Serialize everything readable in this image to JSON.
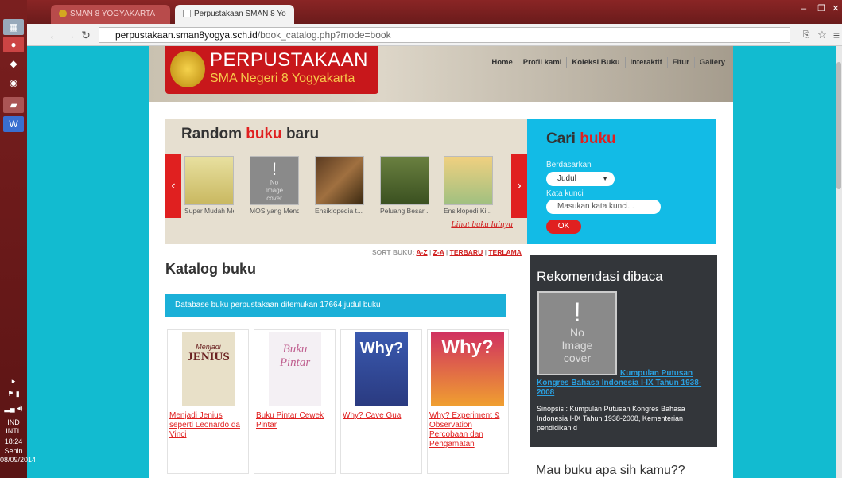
{
  "taskbar": {
    "tray": {
      "lang1": "IND",
      "lang2": "INTL",
      "time": "18:24",
      "day": "Senin",
      "date": "08/09/2014"
    }
  },
  "browser": {
    "tabs": [
      {
        "label": "SMAN 8 YOGYAKARTA",
        "active": false
      },
      {
        "label": "Perpustakaan SMAN 8 Yo",
        "active": true
      }
    ],
    "url_host": "perpustakaan.sman8yogya.sch.id",
    "url_path": "/book_catalog.php?mode=book"
  },
  "header": {
    "logo_title": "PERPUSTAKAAN",
    "logo_subtitle": "SMA Negeri 8 Yogyakarta",
    "menu": [
      "Home",
      "Profil kami",
      "Koleksi Buku",
      "Interaktif",
      "Fitur",
      "Gallery"
    ]
  },
  "random": {
    "title_a": "Random ",
    "title_b": "buku",
    "title_c": " baru",
    "books": [
      {
        "caption": "Super Mudah Me..."
      },
      {
        "caption": "MOS yang Mendi..."
      },
      {
        "caption": "Ensiklopedia t..."
      },
      {
        "caption": "Peluang Besar ..."
      },
      {
        "caption": "Ensiklopedi Ki..."
      }
    ],
    "no_image": {
      "line1": "No",
      "line2": "Image",
      "line3": "cover"
    },
    "more_link": "Lihat buku lainya"
  },
  "search": {
    "title_a": "Cari ",
    "title_b": "buku",
    "label_by": "Berdasarkan",
    "select_value": "Judul",
    "label_keyword": "Kata kunci",
    "keyword_placeholder": "Masukan kata kunci...",
    "ok_label": "OK"
  },
  "sort": {
    "prefix": "SORT BUKU: ",
    "options": [
      "A-Z",
      "Z-A",
      "TERBARU",
      "TERLAMA"
    ],
    "sep": " | "
  },
  "catalog": {
    "title": "Katalog buku",
    "db_text": "Database buku perpustakaan ditemukan 17664 judul buku",
    "books": [
      {
        "caption": "Menjadi Jenius seperti Leonardo da Vinci",
        "cover_top": "Menjadi",
        "cover_big": "JENIUS"
      },
      {
        "caption": "Buku Pintar Cewek Pintar",
        "cover_top": "Buku",
        "cover_big": "Pintar"
      },
      {
        "caption": "Why? Cave Gua",
        "cover_top": "",
        "cover_big": "Why?"
      },
      {
        "caption": "Why? Experiment & Observation Percobaan dan Pengamatan",
        "cover_top": "",
        "cover_big": "Why?"
      }
    ]
  },
  "recommend": {
    "heading": "Rekomendasi dibaca",
    "no_image": {
      "line1": "No",
      "line2": "Image",
      "line3": "cover"
    },
    "title_link": "Kumpulan Putusan Kongres Bahasa Indonesia I-IX Tahun 1938-2008",
    "synopsis": "Sinopsis : Kumpulan Putusan Kongres Bahasa Indonesia I-IX Tahun 1938-2008, Kementerian pendidikan d"
  },
  "mau": {
    "text": "Mau buku apa sih kamu??"
  }
}
